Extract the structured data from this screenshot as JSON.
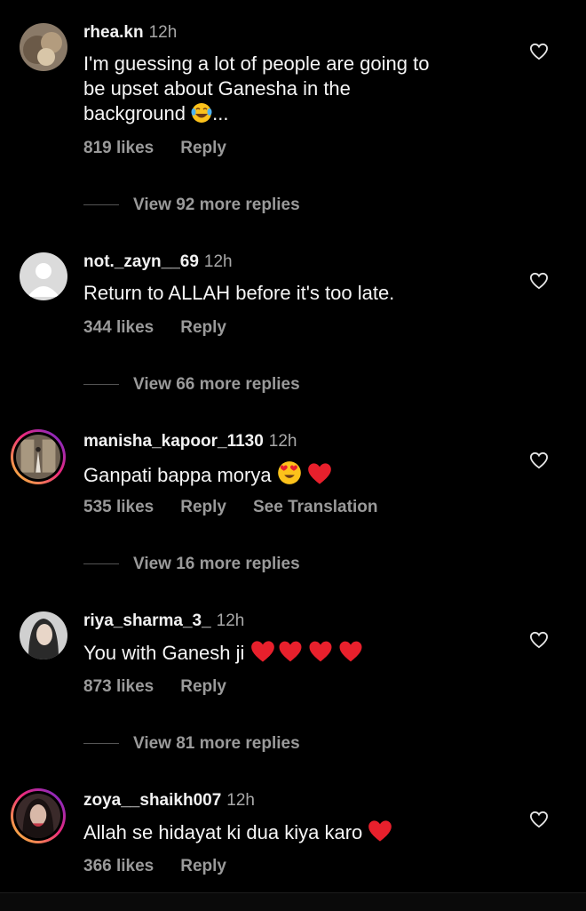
{
  "comments": [
    {
      "username": "rhea.kn",
      "time": "12h",
      "text_lines": [
        "I'm guessing a lot of people are going to",
        "be upset about Ganesha in the",
        "background"
      ],
      "text_suffix": "...",
      "likes": "819 likes",
      "reply": "Reply",
      "view_replies": "View 92 more replies"
    },
    {
      "username": "not._zayn__69",
      "time": "12h",
      "text": "Return to ALLAH before it's too late.",
      "likes": "344 likes",
      "reply": "Reply",
      "view_replies": "View 66 more replies"
    },
    {
      "username": "manisha_kapoor_1130",
      "time": "12h",
      "text": "Ganpati bappa morya",
      "likes": "535 likes",
      "reply": "Reply",
      "translation": "See Translation",
      "view_replies": "View 16 more replies"
    },
    {
      "username": "riya_sharma_3_",
      "time": "12h",
      "text": "You with Ganesh ji",
      "likes": "873 likes",
      "reply": "Reply",
      "view_replies": "View 81 more replies"
    },
    {
      "username": "zoya__shaikh007",
      "time": "12h",
      "text": "Allah se hidayat ki dua kiya karo",
      "likes": "366 likes",
      "reply": "Reply"
    }
  ],
  "icons": {
    "like": "heart-outline-icon",
    "emoji_laugh": "tears-of-joy-emoji",
    "emoji_heart_eyes": "heart-eyes-emoji",
    "emoji_heart": "red-heart-emoji"
  },
  "colors": {
    "background": "#000000",
    "text": "#f5f5f5",
    "secondary": "#9a9a9a",
    "heart_red": "#e8202c"
  }
}
